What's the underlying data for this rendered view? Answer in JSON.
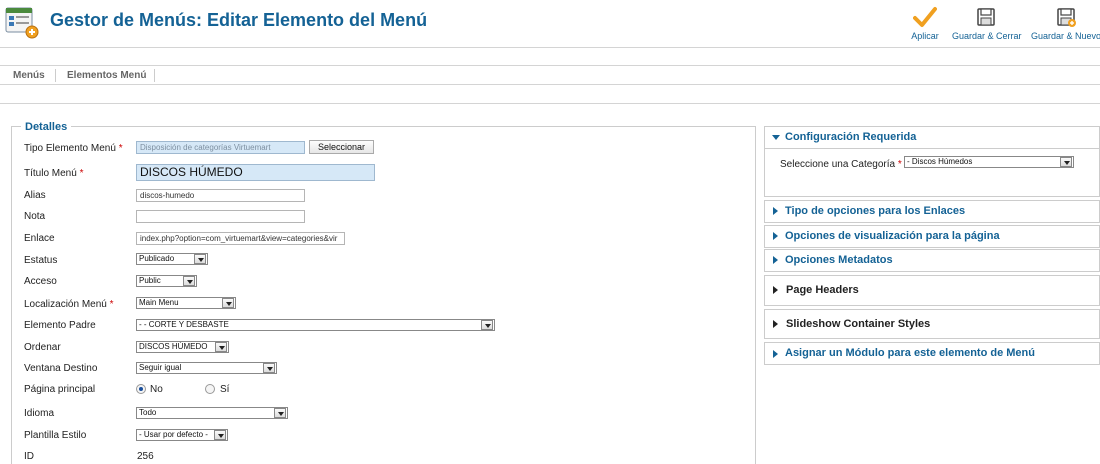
{
  "header": {
    "title": "Gestor de Menús: Editar Elemento del Menú",
    "toolbar": [
      {
        "label": "Aplicar",
        "icon": "check-icon"
      },
      {
        "label": "Guardar & Cerrar",
        "icon": "save-close-icon"
      },
      {
        "label": "Guardar & Nuevo",
        "icon": "save-new-icon"
      }
    ]
  },
  "submenu": [
    {
      "label": "Menús"
    },
    {
      "label": "Elementos Menú"
    }
  ],
  "details": {
    "legend": "Detalles",
    "type_label": "Tipo Elemento Menú",
    "type_value": "Disposición de categorías Virtuemart",
    "select_button": "Seleccionar",
    "title_label": "Título Menú",
    "title_value": "DISCOS HÚMEDO",
    "alias_label": "Alias",
    "alias_value": "discos-humedo",
    "note_label": "Nota",
    "note_value": "",
    "link_label": "Enlace",
    "link_value": "index.php?option=com_virtuemart&view=categories&vir",
    "status_label": "Estatus",
    "status_value": "Publicado",
    "access_label": "Acceso",
    "access_value": "Public",
    "location_label": "Localización Menú",
    "location_value": "Main Menu",
    "parent_label": "Elemento Padre",
    "parent_value": "- - CORTE Y DESBASTE",
    "order_label": "Ordenar",
    "order_value": "DISCOS HÚMEDO",
    "target_label": "Ventana Destino",
    "target_value": "Seguir igual",
    "home_label": "Página principal",
    "home_no": "No",
    "home_yes": "Sí",
    "language_label": "Idioma",
    "language_value": "Todo",
    "template_label": "Plantilla Estilo",
    "template_value": "- Usar por defecto -",
    "id_label": "ID",
    "id_value": "256",
    "required_mark": "*"
  },
  "sidebar": {
    "required_title": "Configuración Requerida",
    "category_label": "Seleccione una Categoría",
    "category_value": "- Discos Húmedos",
    "link_options": "Tipo de opciones para los Enlaces",
    "display_options": "Opciones de visualización para la página",
    "metadata_options": "Opciones Metadatos",
    "page_headers": "Page Headers",
    "slideshow_styles": "Slideshow Container Styles",
    "assign_module": "Asignar un Módulo para este elemento de Menú"
  },
  "colors": {
    "accent": "#146295",
    "input_highlight": "#d6e8f7",
    "required": "#cc0000"
  }
}
